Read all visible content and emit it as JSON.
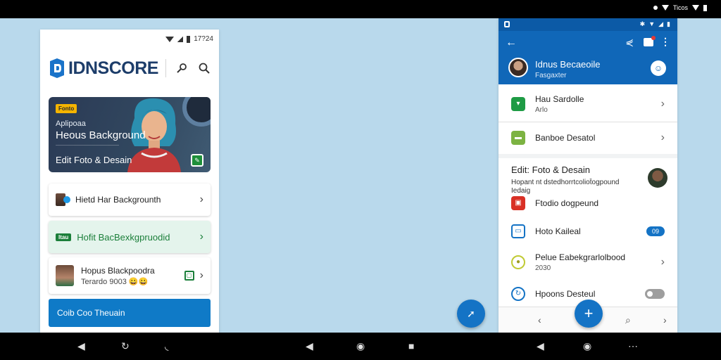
{
  "system": {
    "status_text": "Ticos"
  },
  "left_phone": {
    "time": "17?24",
    "brand": "IDNSCORE",
    "hero": {
      "badge": "Fonto",
      "subtitle": "Aplipoaa",
      "title": "Heous Background",
      "cta": "Edit Foto & Desain"
    },
    "cards": [
      {
        "label": "Hietd Har Backgrounth"
      },
      {
        "tag": "Itau",
        "label": "Hofit BacBexkgpruodid"
      },
      {
        "line1": "Hopus Blackpoodra",
        "line2": "Terardo 9003"
      }
    ],
    "primary_button": "Coib Coo Theuain"
  },
  "right_phone": {
    "header": {
      "name": "Idnus Becaeoile",
      "role": "Fasgaxter"
    },
    "rows": [
      {
        "title": "Hau Sardolle",
        "subtitle": "Arlo"
      },
      {
        "title": "Banboe Desatol"
      }
    ],
    "section": {
      "title": "Edit: Foto & Desain",
      "sub1": "Hopant nt dstedhorrtcoliot̄ogpound",
      "sub2": "Iedaig"
    },
    "items": [
      {
        "title": "Ftodio dogpeund"
      },
      {
        "title": "Hoto Kaileal",
        "pill": "09"
      },
      {
        "title": "Pelue Eabekgrarlolbood",
        "subtitle": "2030"
      },
      {
        "title": "Hpoons Desteul"
      }
    ]
  },
  "colors": {
    "primary": "#1067b8",
    "green": "#1b7f3a",
    "bg": "#b9d9ec"
  }
}
